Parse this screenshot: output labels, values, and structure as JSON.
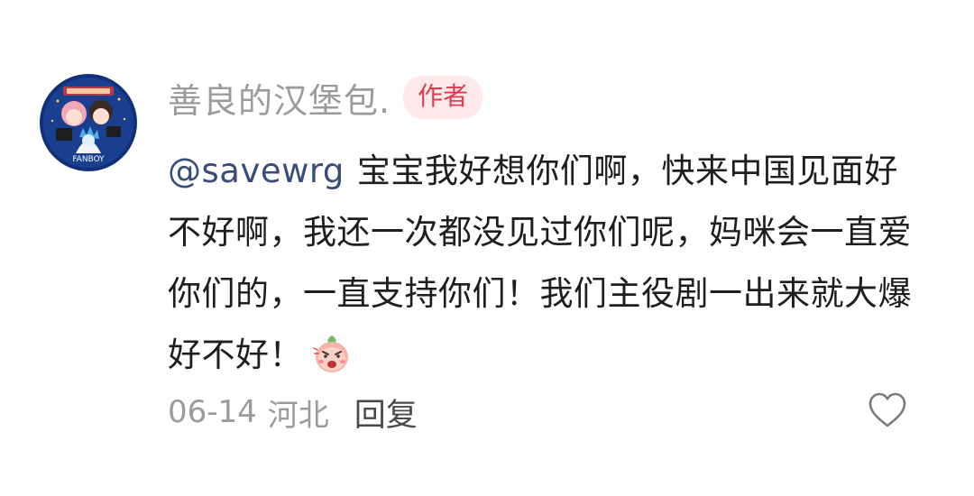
{
  "comment": {
    "username": "善良的汉堡包.",
    "author_badge": "作者",
    "mention": "@savewrg",
    "text": "宝宝我好想你们啊，快来中国见面好不好啊，我还一次都没见过你们呢，妈咪会一直爱你们的，一直支持你们！我们主役剧一出来就大爆好不好！",
    "emoji": "angry-peach-sticker",
    "avatar_text": "FANBOY",
    "date": "06-14",
    "location": "河北",
    "reply_label": "回复",
    "like_icon": "heart-outline-icon"
  },
  "colors": {
    "username": "#9b9b9b",
    "badge_text": "#e03a4e",
    "badge_bg": "#fde9ea",
    "mention": "#3a4d7a",
    "body_text": "#1e1e1e",
    "meta": "#9b9b9b"
  }
}
